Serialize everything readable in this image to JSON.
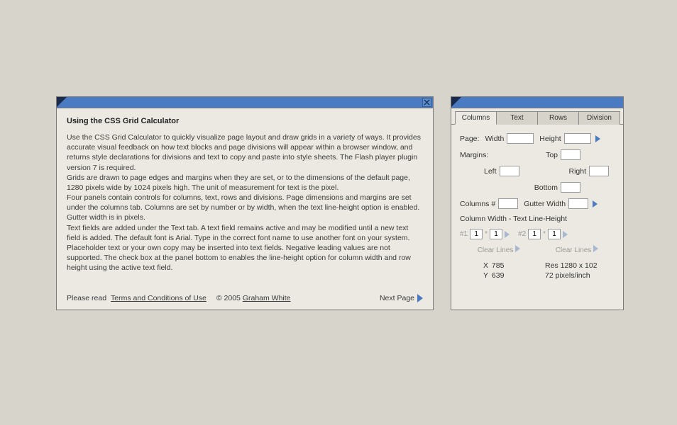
{
  "left": {
    "title": "Using the CSS Grid Calculator",
    "p1": "Use the CSS Grid Calculator to quickly visualize page layout and draw grids in a variety of ways. It provides accurate visual feedback on how text blocks and page divisions will appear within a browser window, and returns style declarations for divisions and text to copy and paste into style sheets. The Flash player plugin version 7 is required.",
    "p2": "Grids are drawn to page edges and margins when they are set, or to the dimensions of the default page, 1280 pixels wide by 1024 pixels high. The unit of measurement for text is the pixel.",
    "p3": "Four panels contain controls for columns, text, rows and divisions. Page dimensions and margins are set under the columns tab. Columns are set by number or by width, when the text line-height option is enabled. Gutter width is in pixels.",
    "p4": "Text fields are added under the Text tab. A text field remains active and may be modified until a new text field is added. The default font is Arial. Type in the correct font name to use another font on your system. Placeholder text or your own copy may be inserted into text fields. Negative leading values are not supported. The check box at the panel bottom to enables the line-height option for column width and row height using the active text field.",
    "footer": {
      "please_read": "Please read",
      "terms_link": "Terms and Conditions of Use",
      "copyright": "© 2005",
      "author_link": "Graham White",
      "next_page": "Next Page"
    }
  },
  "right": {
    "tabs": [
      "Columns",
      "Text",
      "Rows",
      "Division"
    ],
    "labels": {
      "page": "Page:",
      "width": "Width",
      "height": "Height",
      "margins": "Margins:",
      "top": "Top",
      "left": "Left",
      "right": "Right",
      "bottom": "Bottom",
      "columns_num": "Columns #",
      "gutter_width": "Gutter Width",
      "section": "Column Width - Text Line-Height",
      "hash1": "#1",
      "hash2": "#2",
      "star": "*",
      "one": "1",
      "clear_lines": "Clear Lines"
    },
    "stats": {
      "x_label": "X",
      "x_value": "785",
      "y_label": "Y",
      "y_value": "639",
      "res_label": "Res",
      "res_value": "1280 x 102",
      "ppi": "72 pixels/inch"
    }
  }
}
